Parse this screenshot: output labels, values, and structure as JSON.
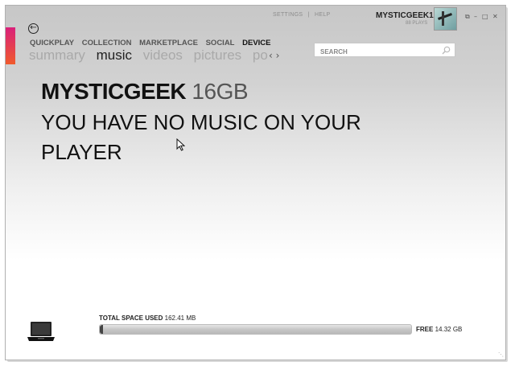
{
  "nav": {
    "back_icon": "back-arrow-icon",
    "top_links": [
      "SETTINGS",
      "|",
      "HELP"
    ],
    "pivots": [
      "QUICKPLAY",
      "COLLECTION",
      "MARKETPLACE",
      "SOCIAL",
      "DEVICE"
    ],
    "active_pivot": "DEVICE",
    "sub_pivots": [
      "summary",
      "music",
      "videos",
      "pictures",
      "pod"
    ],
    "active_sub_pivot": "music",
    "prev_icon": "chevron-left-icon",
    "next_icon": "chevron-right-icon"
  },
  "user": {
    "name": "MYSTICGEEK1",
    "plays": "88 PLAYS"
  },
  "window_controls": [
    "compact-mode-icon",
    "minimize-icon",
    "maximize-icon",
    "close-icon"
  ],
  "search": {
    "placeholder": "SEARCH",
    "value": ""
  },
  "device": {
    "name": "MYSTICGEEK",
    "capacity": "16GB",
    "message": "YOU HAVE NO MUSIC ON YOUR PLAYER"
  },
  "storage": {
    "used_label": "TOTAL SPACE USED",
    "used_value": "162.41 MB",
    "free_label": "FREE",
    "free_value": "14.32 GB",
    "used_fraction": 0.011
  },
  "colors": {
    "accent_top": "#d9207a",
    "accent_bottom": "#f05a2c"
  }
}
